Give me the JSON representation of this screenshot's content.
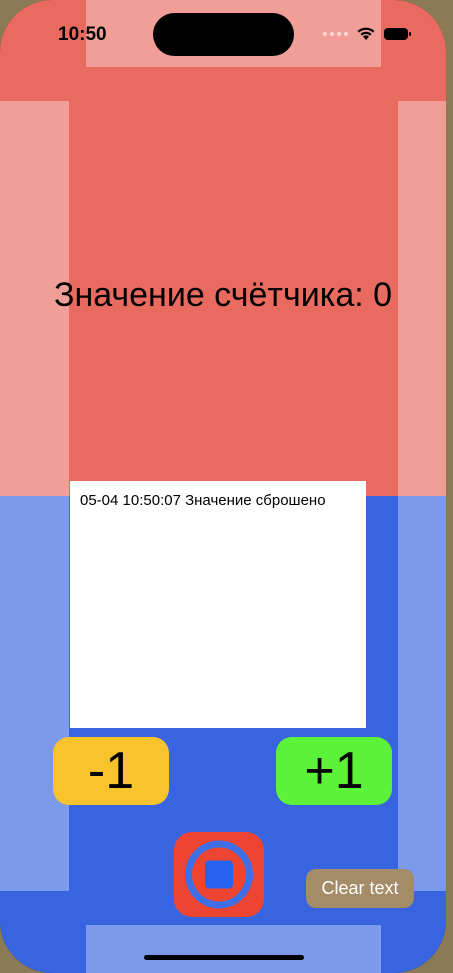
{
  "status_bar": {
    "time": "10:50",
    "icons": [
      "cellular-signal-icon",
      "wifi-icon",
      "battery-icon"
    ]
  },
  "counter": {
    "label": "Значение счётчика: 0"
  },
  "log": {
    "lines": [
      "05-04 10:50:07 Значение сброшено"
    ]
  },
  "buttons": {
    "decrement_label": "-1",
    "increment_label": "+1",
    "stop_icon": "stop-icon",
    "clear_label": "Clear text"
  },
  "colors": {
    "top_background": "#e96b60",
    "bottom_background": "#3865df",
    "decrement_button": "#f8c32d",
    "increment_button": "#5df23a",
    "stop_button": "#ee4432",
    "clear_button": "#a38c67"
  }
}
